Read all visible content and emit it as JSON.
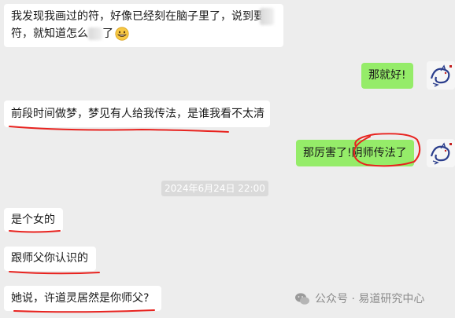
{
  "messages": {
    "m1_line1": "我发现我画过的符，好像已经刻在脑子里了，说到要",
    "m1_line2a": "符，就知道怎么",
    "m1_line2b": "了",
    "m2": "那就好!",
    "m3": "前段时间做梦，梦见有人给我传法，是谁我看不太清",
    "m4a": "那厉害了!",
    "m4b": "阴师传法了",
    "m5": "是个女的",
    "m6": "跟师父你认识的",
    "m7": "她说，许道灵居然是你师父?"
  },
  "timestamp": "2024年6月24日 22:00",
  "watermark": {
    "label": "公众号 · 易道研究中心",
    "icon": "wechat-icon"
  },
  "colors": {
    "background": "#ededed",
    "my_bubble": "#95ec69",
    "their_bubble": "#ffffff",
    "annotation": "#e8231f"
  }
}
